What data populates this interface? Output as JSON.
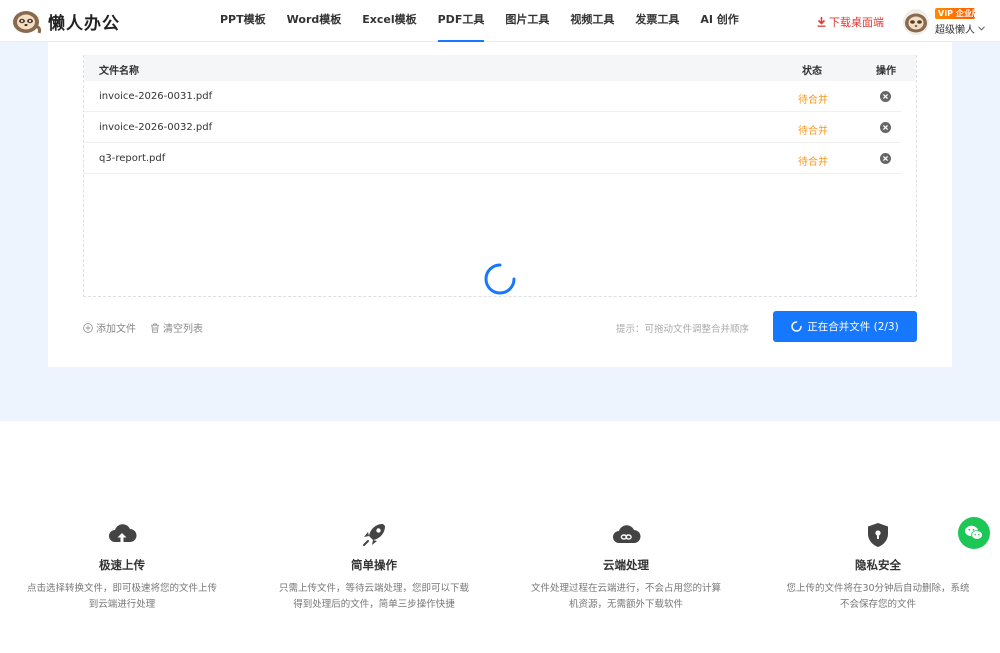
{
  "header": {
    "logo_text": "懒人办公",
    "nav": [
      {
        "label": "PPT模板"
      },
      {
        "label": "Word模板"
      },
      {
        "label": "Excel模板"
      },
      {
        "label": "PDF工具",
        "active": true
      },
      {
        "label": "图片工具"
      },
      {
        "label": "视频工具"
      },
      {
        "label": "发票工具"
      },
      {
        "label": "AI 创作"
      }
    ],
    "download_label": "下载桌面端",
    "vip_badge": "VIP 企业版",
    "user_name": "超级懒人"
  },
  "table": {
    "headers": {
      "name": "文件名称",
      "status": "状态",
      "action": "操作"
    },
    "rows": [
      {
        "name": "invoice-2026-0031.pdf",
        "status": "待合并"
      },
      {
        "name": "invoice-2026-0032.pdf",
        "status": "待合并"
      },
      {
        "name": "q3-report.pdf",
        "status": "待合并"
      }
    ]
  },
  "actions": {
    "add_file": "添加文件",
    "clear_list": "清空列表",
    "hint": "提示：可拖动文件调整合并顺序",
    "merge_button": "正在合并文件 (2/3)"
  },
  "features": [
    {
      "icon": "cloud-upload-icon",
      "title": "极速上传",
      "desc": "点击选择转换文件，即可极速将您的文件上传到云端进行处理"
    },
    {
      "icon": "rocket-icon",
      "title": "简单操作",
      "desc": "只需上传文件，等待云端处理，您即可以下载得到处理后的文件，简单三步操作快捷"
    },
    {
      "icon": "cloud-link-icon",
      "title": "云端处理",
      "desc": "文件处理过程在云端进行，不会占用您的计算机资源，无需额外下载软件"
    },
    {
      "icon": "shield-lock-icon",
      "title": "隐私安全",
      "desc": "您上传的文件将在30分钟后自动删除，系统不会保存您的文件"
    }
  ],
  "colors": {
    "accent": "#1677ff",
    "pending": "#f59a23",
    "download": "#e53935",
    "wechat": "#1dc756",
    "band": "#eef4fd"
  }
}
